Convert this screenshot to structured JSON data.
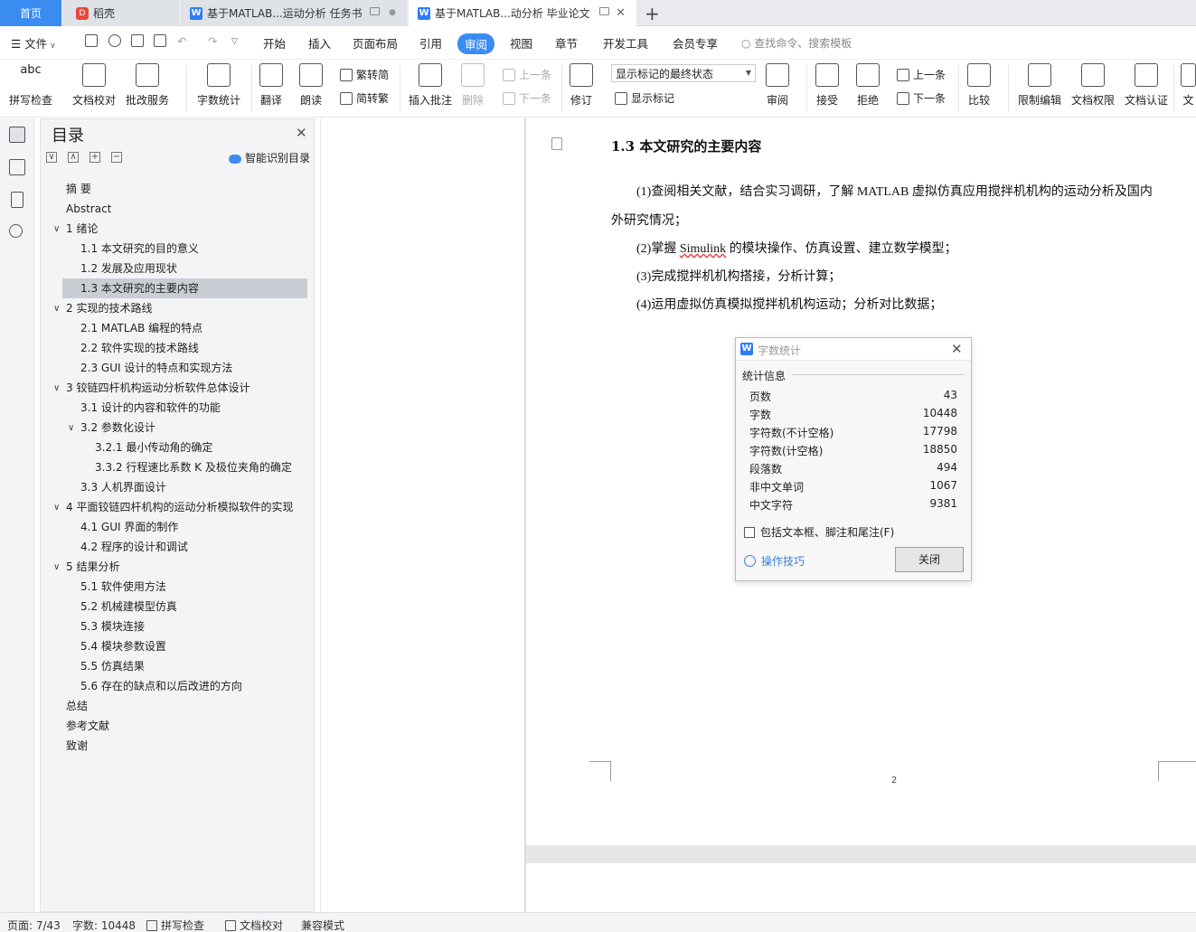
{
  "tabs": {
    "home": "首页",
    "daoke": "稻壳",
    "doc1": "基于MATLAB...运动分析 任务书",
    "doc2": "基于MATLAB...动分析 毕业论文"
  },
  "menu": {
    "file": "文件",
    "items": [
      "开始",
      "插入",
      "页面布局",
      "引用",
      "审阅",
      "视图",
      "章节",
      "开发工具",
      "会员专享"
    ],
    "search_placeholder": "查找命令、搜索模板"
  },
  "ribbon": {
    "spellcheck": "拼写检查",
    "doc_check": "文档校对",
    "revise_service": "批改服务",
    "word_count": "字数统计",
    "translate": "翻译",
    "read_aloud": "朗读",
    "to_simplified": "繁转简",
    "to_traditional": "简转繁",
    "insert_comment": "插入批注",
    "delete": "删除",
    "prev_comment": "上一条",
    "next_comment": "下一条",
    "track_changes": "修订",
    "markup_state": "显示标记的最终状态",
    "show_markup": "显示标记",
    "review_pane": "审阅",
    "accept": "接受",
    "reject": "拒绝",
    "prev_change": "上一条",
    "next_change": "下一条",
    "compare": "比较",
    "restrict_edit": "限制编辑",
    "doc_permission": "文档权限",
    "doc_cert": "文档认证",
    "more": "文"
  },
  "toc": {
    "title": "目录",
    "smart": "智能识别目录",
    "items": [
      "摘  要",
      "Abstract",
      "1  绪论",
      "1.1  本文研究的目的意义",
      "1.2  发展及应用现状",
      "1.3  本文研究的主要内容",
      "2  实现的技术路线",
      "2.1 MATLAB 编程的特点",
      "2.2  软件实现的技术路线",
      "2.3 GUI 设计的特点和实现方法",
      "3  铰链四杆机构运动分析软件总体设计",
      "3.1  设计的内容和软件的功能",
      "3.2  参数化设计",
      "3.2.1  最小传动角的确定",
      "3.3.2  行程速比系数 K 及极位夹角的确定",
      "3.3  人机界面设计",
      "4  平面铰链四杆机构的运动分析模拟软件的实现",
      "4.1 GUI 界面的制作",
      "4.2  程序的设计和调试",
      "5  结果分析",
      "5.1 软件使用方法",
      "5.2  机械建模型仿真",
      "5.3  模块连接",
      "5.4  模块参数设置",
      "5.5  仿真结果",
      "5.6  存在的缺点和以后改进的方向",
      "总结",
      "参考文献",
      "致谢"
    ]
  },
  "document": {
    "heading": "1.3  本文研究的主要内容",
    "p1a": "(1)查阅相关文献，结合实习调研，了解 MATLAB 虚拟仿真应用搅拌机机构的运动分析及国内",
    "p1b": "外研究情况；",
    "p2_pre": "(2)掌握 ",
    "p2_term": "Simulink",
    "p2_post": " 的模块操作、仿真设置、建立数学模型；",
    "p3": "(3)完成搅拌机机构搭接，分析计算；",
    "p4": "(4)运用虚拟仿真模拟搅拌机机构运动；分析对比数据；",
    "page_number": "2"
  },
  "dialog": {
    "title": "字数统计",
    "group": "统计信息",
    "stats": [
      {
        "label": "页数",
        "value": "43"
      },
      {
        "label": "字数",
        "value": "10448"
      },
      {
        "label": "字符数(不计空格)",
        "value": "17798"
      },
      {
        "label": "字符数(计空格)",
        "value": "18850"
      },
      {
        "label": "段落数",
        "value": "494"
      },
      {
        "label": "非中文单词",
        "value": "1067"
      },
      {
        "label": "中文字符",
        "value": "9381"
      }
    ],
    "include_label": "包括文本框、脚注和尾注(F)",
    "tips": "操作技巧",
    "close": "关闭"
  },
  "status": {
    "page": "页面: 7/43",
    "words": "字数: 10448",
    "spell": "拼写检查",
    "check": "文档校对",
    "compat": "兼容模式"
  }
}
